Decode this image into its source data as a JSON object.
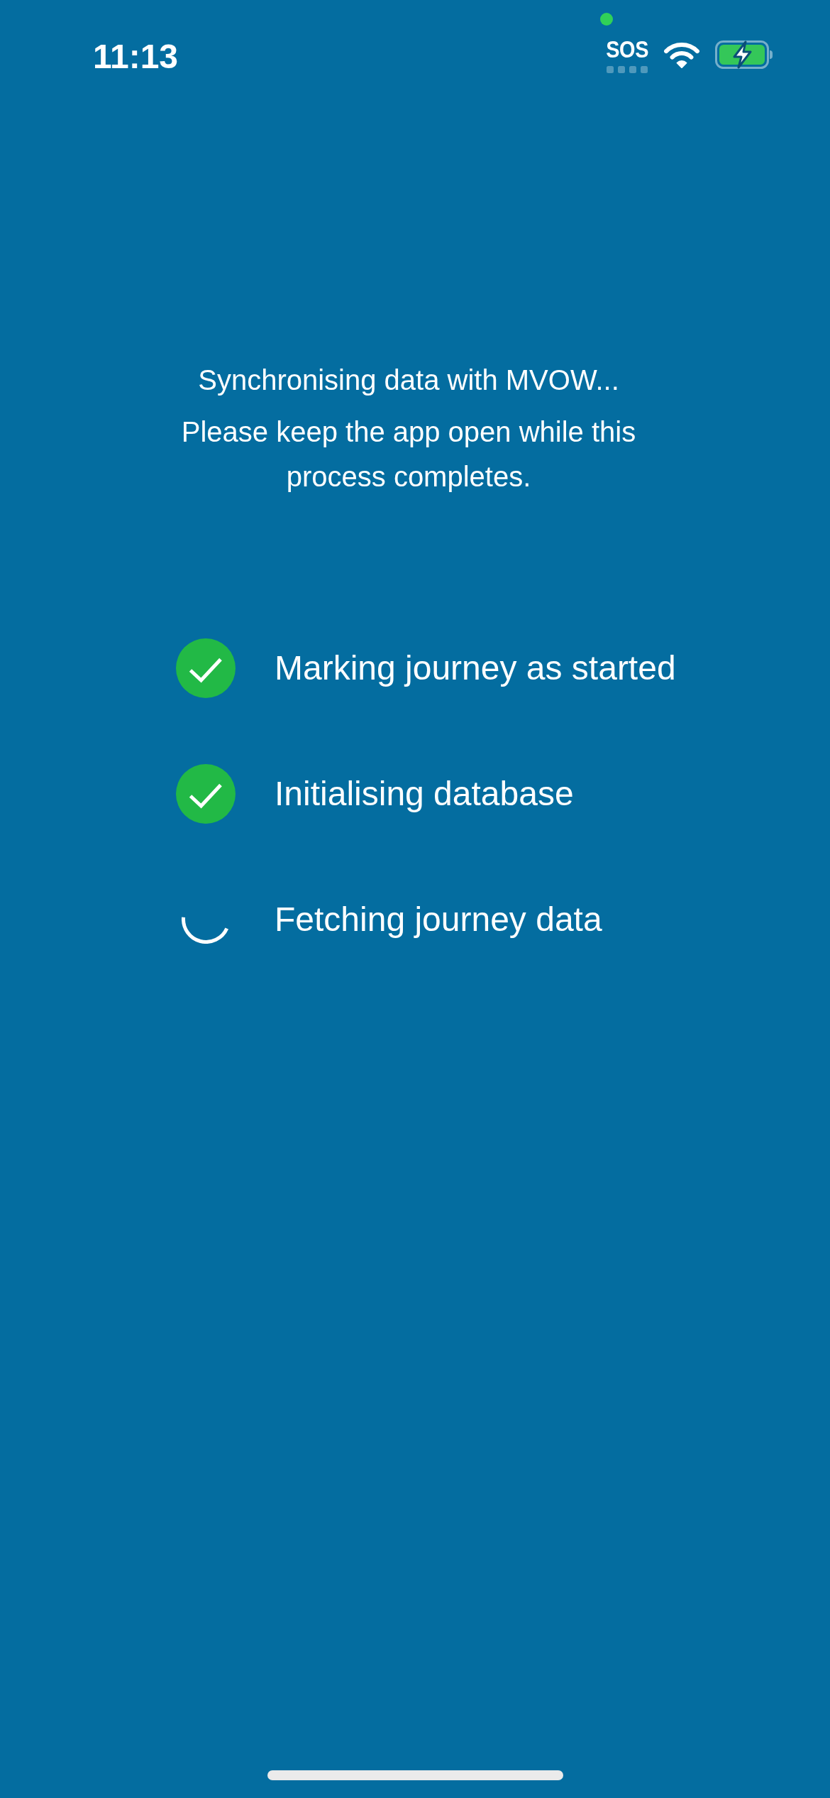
{
  "status_bar": {
    "time": "11:13",
    "sos": "SOS"
  },
  "message": {
    "title": "Synchronising data with MVOW...",
    "body": "Please keep the app open while this process completes."
  },
  "steps": [
    {
      "label": "Marking journey as started",
      "completed": true
    },
    {
      "label": "Initialising database",
      "completed": true
    },
    {
      "label": "Fetching journey data",
      "completed": false
    }
  ]
}
